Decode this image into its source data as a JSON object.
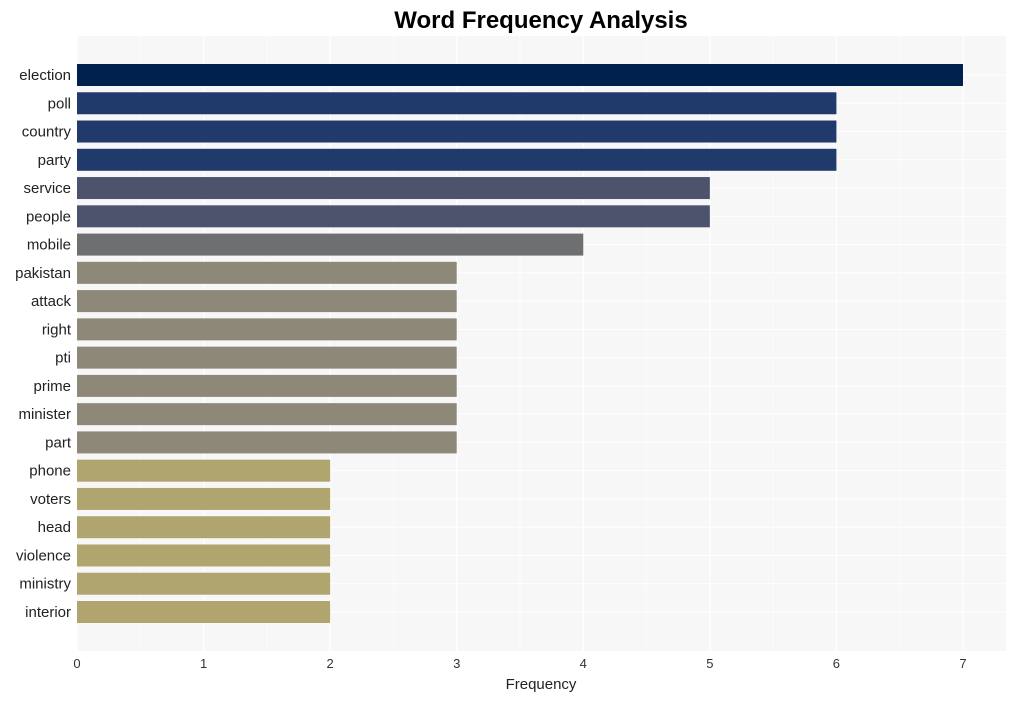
{
  "chart_data": {
    "type": "bar",
    "orientation": "horizontal",
    "title": "Word Frequency Analysis",
    "xlabel": "Frequency",
    "ylabel": "",
    "xlim": [
      0,
      7.35
    ],
    "xticks": [
      0,
      1,
      2,
      3,
      4,
      5,
      6,
      7
    ],
    "grid": true,
    "categories": [
      "election",
      "poll",
      "country",
      "party",
      "service",
      "people",
      "mobile",
      "pakistan",
      "attack",
      "right",
      "pti",
      "prime",
      "minister",
      "part",
      "phone",
      "voters",
      "head",
      "violence",
      "ministry",
      "interior"
    ],
    "values": [
      7,
      6,
      6,
      6,
      5,
      5,
      4,
      3,
      3,
      3,
      3,
      3,
      3,
      3,
      2,
      2,
      2,
      2,
      2,
      2
    ],
    "colors_by_value": {
      "7": "#00214e",
      "6": "#203a6c",
      "5": "#4d536c",
      "4": "#6e6f71",
      "3": "#8d8877",
      "2": "#b0a46f"
    },
    "background": "#f7f7f7"
  }
}
